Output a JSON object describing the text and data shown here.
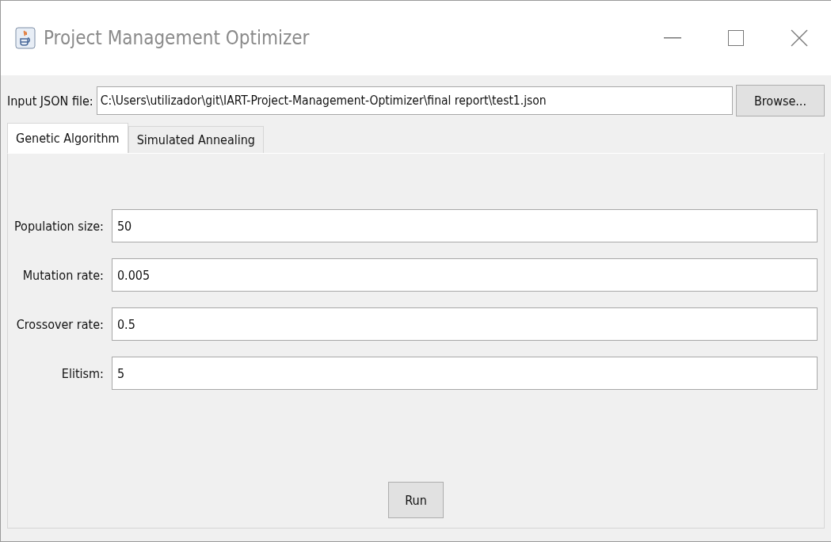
{
  "window": {
    "title": "Project Management Optimizer"
  },
  "file_input": {
    "label": "Input JSON file:",
    "value": "C:\\Users\\utilizador\\git\\IART-Project-Management-Optimizer\\final report\\test1.json",
    "button": "Browse..."
  },
  "tabs": [
    {
      "label": "Genetic Algorithm",
      "selected": true
    },
    {
      "label": "Simulated Annealing",
      "selected": false
    }
  ],
  "fields": [
    {
      "label": "Population size:",
      "value": "50"
    },
    {
      "label": "Mutation rate:",
      "value": "0.005"
    },
    {
      "label": "Crossover rate:",
      "value": "0.5"
    },
    {
      "label": "Elitism:",
      "value": "5"
    }
  ],
  "run_button": "Run"
}
